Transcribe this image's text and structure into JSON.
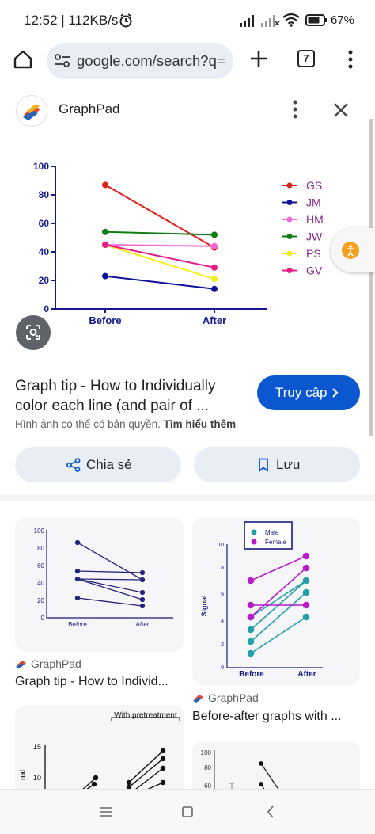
{
  "status_bar": {
    "time": "12:52 | 112KB/s",
    "battery": "67%"
  },
  "browser": {
    "url": "google.com/search?q=",
    "tab_count": "7"
  },
  "panel": {
    "source": "GraphPad",
    "title_line1": "Graph tip - How to Individually",
    "title_line2": "color each line (and pair of ...",
    "copyright": "Hình ảnh có thể có bản quyền.",
    "learn_more": "Tìm hiểu thêm",
    "visit_label": "Truy cập",
    "share_label": "Chia sẻ",
    "save_label": "Lưu"
  },
  "chart_data": {
    "type": "line",
    "x": [
      "Before",
      "After"
    ],
    "ylim": [
      0,
      100
    ],
    "yticks": [
      "0",
      "20",
      "40",
      "60",
      "80",
      "100"
    ],
    "legend_position": "right",
    "series": [
      {
        "name": "GS",
        "values": [
          87,
          43
        ],
        "color": "#e0201b"
      },
      {
        "name": "JM",
        "values": [
          23,
          14
        ],
        "color": "#10139a"
      },
      {
        "name": "HM",
        "values": [
          45,
          44
        ],
        "color": "#f06ad6"
      },
      {
        "name": "JW",
        "values": [
          54,
          52
        ],
        "color": "#0f7d16"
      },
      {
        "name": "PS",
        "values": [
          45,
          21
        ],
        "color": "#f2ee1e"
      },
      {
        "name": "GV",
        "values": [
          45,
          29
        ],
        "color": "#e81c86"
      }
    ]
  },
  "related": [
    {
      "source": "GraphPad",
      "title": "Graph tip - How to Individ..."
    },
    {
      "source": "GraphPad",
      "title": "Before-after graphs with ..."
    }
  ],
  "related_charts": {
    "card1": {
      "yticks": [
        "0",
        "20",
        "40",
        "60",
        "80",
        "100"
      ],
      "xlabels": [
        "Before",
        "After"
      ]
    },
    "card2": {
      "yticks": [
        "0",
        "2",
        "4",
        "6",
        "8",
        "10"
      ],
      "xlabels": [
        "Before",
        "After"
      ],
      "ylabel": "Signal",
      "legend": [
        "Male",
        "Female"
      ]
    },
    "card3": {
      "header": "With pretreatment",
      "yticks": [
        "15",
        "10"
      ],
      "ylabel": "nal"
    },
    "card4": {
      "yticks": [
        "100",
        "80",
        "60"
      ]
    }
  },
  "colors": {
    "accent": "#0b57d0",
    "pill_bg": "#e9eef6"
  }
}
